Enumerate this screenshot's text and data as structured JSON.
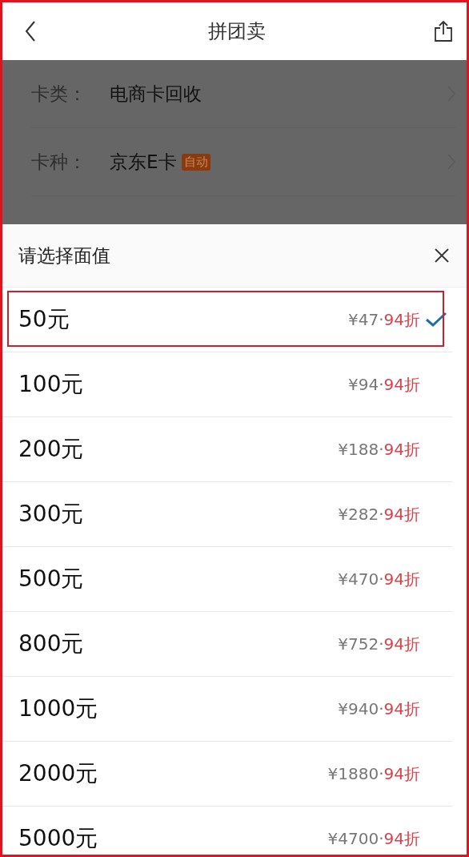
{
  "header": {
    "title": "拼团卖"
  },
  "form": [
    {
      "label": "卡类：",
      "value": "电商卡回收"
    },
    {
      "label": "卡种：",
      "value": "京东E卡",
      "badge": "自动"
    }
  ],
  "sheet": {
    "title": "请选择面值",
    "options": [
      {
        "label": "50元",
        "price": "¥47",
        "sep": "·",
        "discount": "94折",
        "selected": true
      },
      {
        "label": "100元",
        "price": "¥94",
        "sep": "·",
        "discount": "94折",
        "selected": false
      },
      {
        "label": "200元",
        "price": "¥188",
        "sep": "·",
        "discount": "94折",
        "selected": false
      },
      {
        "label": "300元",
        "price": "¥282",
        "sep": "·",
        "discount": "94折",
        "selected": false
      },
      {
        "label": "500元",
        "price": "¥470",
        "sep": "·",
        "discount": "94折",
        "selected": false
      },
      {
        "label": "800元",
        "price": "¥752",
        "sep": "·",
        "discount": "94折",
        "selected": false
      },
      {
        "label": "1000元",
        "price": "¥940",
        "sep": "·",
        "discount": "94折",
        "selected": false
      },
      {
        "label": "2000元",
        "price": "¥1880",
        "sep": "·",
        "discount": "94折",
        "selected": false
      },
      {
        "label": "5000元",
        "price": "¥4700",
        "sep": "·",
        "discount": "94折",
        "selected": false
      }
    ]
  }
}
